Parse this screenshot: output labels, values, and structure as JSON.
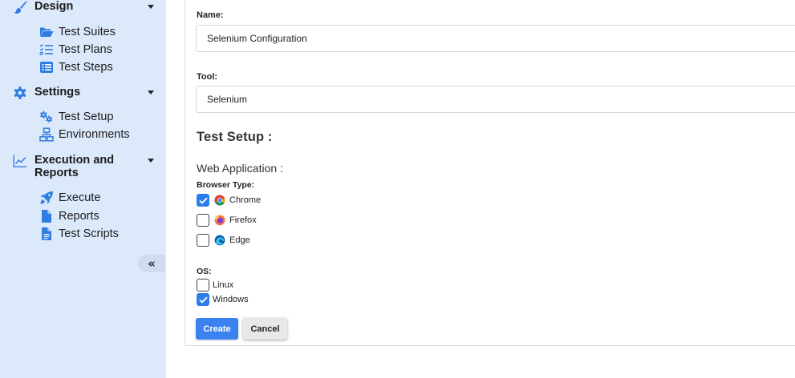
{
  "sidebar": {
    "sections": [
      {
        "label": "Design",
        "icon": "paintbrush-icon",
        "items": [
          {
            "label": "Test Suites",
            "icon": "folder-open-icon"
          },
          {
            "label": "Test Plans",
            "icon": "checklist-icon"
          },
          {
            "label": "Test Steps",
            "icon": "list-icon"
          }
        ]
      },
      {
        "label": "Settings",
        "icon": "gear-icon",
        "items": [
          {
            "label": "Test Setup",
            "icon": "gears-icon"
          },
          {
            "label": "Environments",
            "icon": "network-icon"
          }
        ]
      },
      {
        "label": "Execution and Reports",
        "label_line1": "Execution and",
        "label_line2": "Reports",
        "icon": "chart-line-icon",
        "items": [
          {
            "label": "Execute",
            "icon": "rocket-icon"
          },
          {
            "label": "Reports",
            "icon": "file-icon"
          },
          {
            "label": "Test Scripts",
            "icon": "file-text-icon"
          }
        ]
      }
    ],
    "collapse_label": "«"
  },
  "form": {
    "name_label": "Name:",
    "name_value": "Selenium Configuration",
    "tool_label": "Tool:",
    "tool_value": "Selenium",
    "setup_heading": "Test Setup :",
    "webapp_heading": "Web Application :",
    "browser_label": "Browser Type:",
    "browsers": [
      {
        "label": "Chrome",
        "checked": true,
        "icon": "chrome-icon"
      },
      {
        "label": "Firefox",
        "checked": false,
        "icon": "firefox-icon"
      },
      {
        "label": "Edge",
        "checked": false,
        "icon": "edge-icon"
      }
    ],
    "os_label": "OS:",
    "os_options": [
      {
        "label": "Linux",
        "checked": false
      },
      {
        "label": "Windows",
        "checked": true
      }
    ],
    "create_label": "Create",
    "cancel_label": "Cancel"
  },
  "colors": {
    "sidebar_bg": "#dce9fb",
    "icon_blue": "#2f7de1",
    "primary": "#3b82f0"
  }
}
